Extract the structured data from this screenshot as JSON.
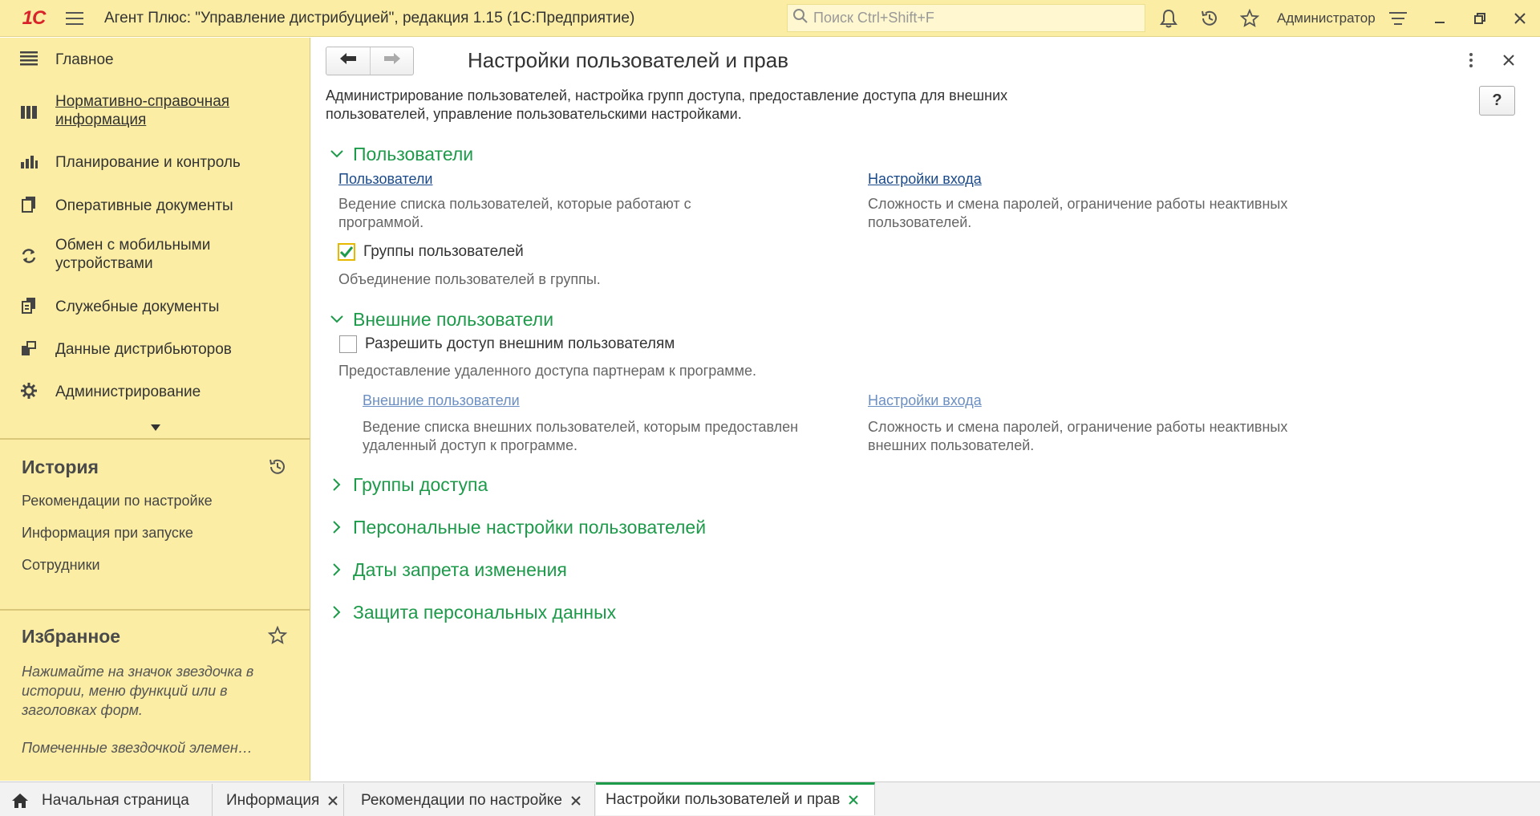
{
  "titlebar": {
    "logo": "1С",
    "title": "Агент Плюс: \"Управление дистрибуцией\", редакция 1.15  (1С:Предприятие)",
    "search_placeholder": "Поиск Ctrl+Shift+F",
    "user": "Администратор"
  },
  "sidebar": {
    "items": [
      {
        "label": "Главное",
        "icon": "list-icon"
      },
      {
        "label": "Нормативно-справочная информация",
        "icon": "catalog-icon"
      },
      {
        "label": "Планирование и контроль",
        "icon": "chart-icon"
      },
      {
        "label": "Оперативные документы",
        "icon": "documents-icon"
      },
      {
        "label": "Обмен с мобильными устройствами",
        "icon": "sync-icon"
      },
      {
        "label": "Служебные документы",
        "icon": "service-docs-icon"
      },
      {
        "label": "Данные дистрибьюторов",
        "icon": "distributor-icon"
      },
      {
        "label": "Администрирование",
        "icon": "gear-icon"
      }
    ],
    "history": {
      "title": "История",
      "items": [
        "Рекомендации по настройке",
        "Информация при запуске",
        "Сотрудники"
      ]
    },
    "favorites": {
      "title": "Избранное",
      "hint": "Нажимайте на значок звездочка в истории, меню функций или в заголовках форм.",
      "hint2": "Помеченные звездочкой элемен…"
    }
  },
  "form": {
    "title": "Настройки пользователей и прав",
    "help": "?",
    "description": "Администрирование пользователей, настройка групп доступа, предоставление доступа для внешних пользователей, управление пользовательскими настройками.",
    "sections": {
      "users": {
        "title": "Пользователи",
        "users_link": "Пользователи",
        "users_desc": "Ведение списка пользователей, которые работают с программой.",
        "login_link": "Настройки входа",
        "login_desc": "Сложность и смена паролей, ограничение работы неактивных пользователей.",
        "groups_checkbox": "Группы пользователей",
        "groups_checked": true,
        "groups_desc": "Объединение пользователей в группы."
      },
      "external": {
        "title": "Внешние пользователи",
        "allow_checkbox": "Разрешить доступ внешним пользователям",
        "allow_checked": false,
        "allow_desc": "Предоставление удаленного доступа партнерам к программе.",
        "ext_link": "Внешние пользователи",
        "ext_desc": "Ведение списка внешних пользователей, которым предоставлен удаленный доступ к программе.",
        "login_link": "Настройки входа",
        "login_desc": "Сложность и смена паролей, ограничение работы неактивных внешних пользователей."
      },
      "collapsed": [
        "Группы доступа",
        "Персональные настройки пользователей",
        "Даты запрета изменения",
        "Защита персональных данных"
      ]
    }
  },
  "tabs": [
    {
      "label": "Начальная страница",
      "icon": "home-icon"
    },
    {
      "label": "Информация"
    },
    {
      "label": "Рекомендации по настройке"
    },
    {
      "label": "Настройки пользователей и прав",
      "active": true
    }
  ],
  "colors": {
    "panel": "#fbeda4",
    "accent_green": "#1d9a4a",
    "link_blue": "#1a4a8a",
    "logo_red": "#d9232a"
  }
}
